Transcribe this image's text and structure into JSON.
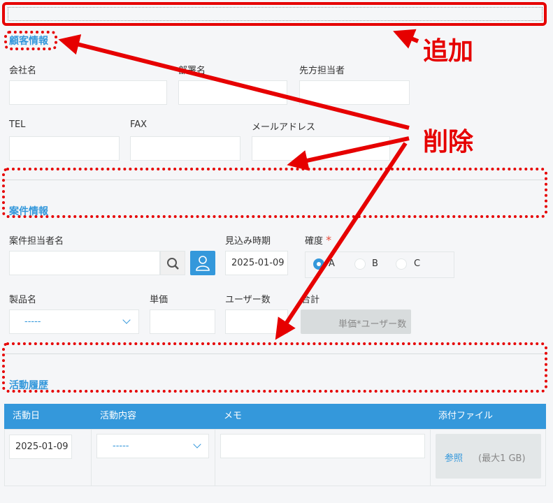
{
  "annotations": {
    "add": "追加",
    "delete": "削除"
  },
  "customer_section": {
    "title": "顧客情報",
    "company_label": "会社名",
    "dept_label": "部署名",
    "contact_label": "先方担当者",
    "tel_label": "TEL",
    "fax_label": "FAX",
    "email_label": "メールアドレス"
  },
  "deal_section": {
    "title": "案件情報",
    "owner_label": "案件担当者名",
    "expected_label": "見込み時期",
    "expected_value": "2025-01-09",
    "certainty_label": "確度",
    "required_mark": "*",
    "certainty_options": [
      "A",
      "B",
      "C"
    ],
    "certainty_selected": "A",
    "product_label": "製品名",
    "product_value": "-----",
    "price_label": "単価",
    "users_label": "ユーザー数",
    "total_label": "合計",
    "total_formula": "単価*ユーザー数"
  },
  "activity_section": {
    "title": "活動履歴",
    "columns": [
      "活動日",
      "活動内容",
      "メモ",
      "添付ファイル"
    ],
    "row": {
      "date": "2025-01-09",
      "content": "-----",
      "browse_label": "参照",
      "max_size": "(最大1 GB)"
    }
  },
  "colors": {
    "accent": "#3498db",
    "annotation": "#e60000",
    "background": "#f5f6f8"
  },
  "icons": [
    "search-icon",
    "user-icon",
    "chevron-down-icon",
    "arrow-icon"
  ]
}
